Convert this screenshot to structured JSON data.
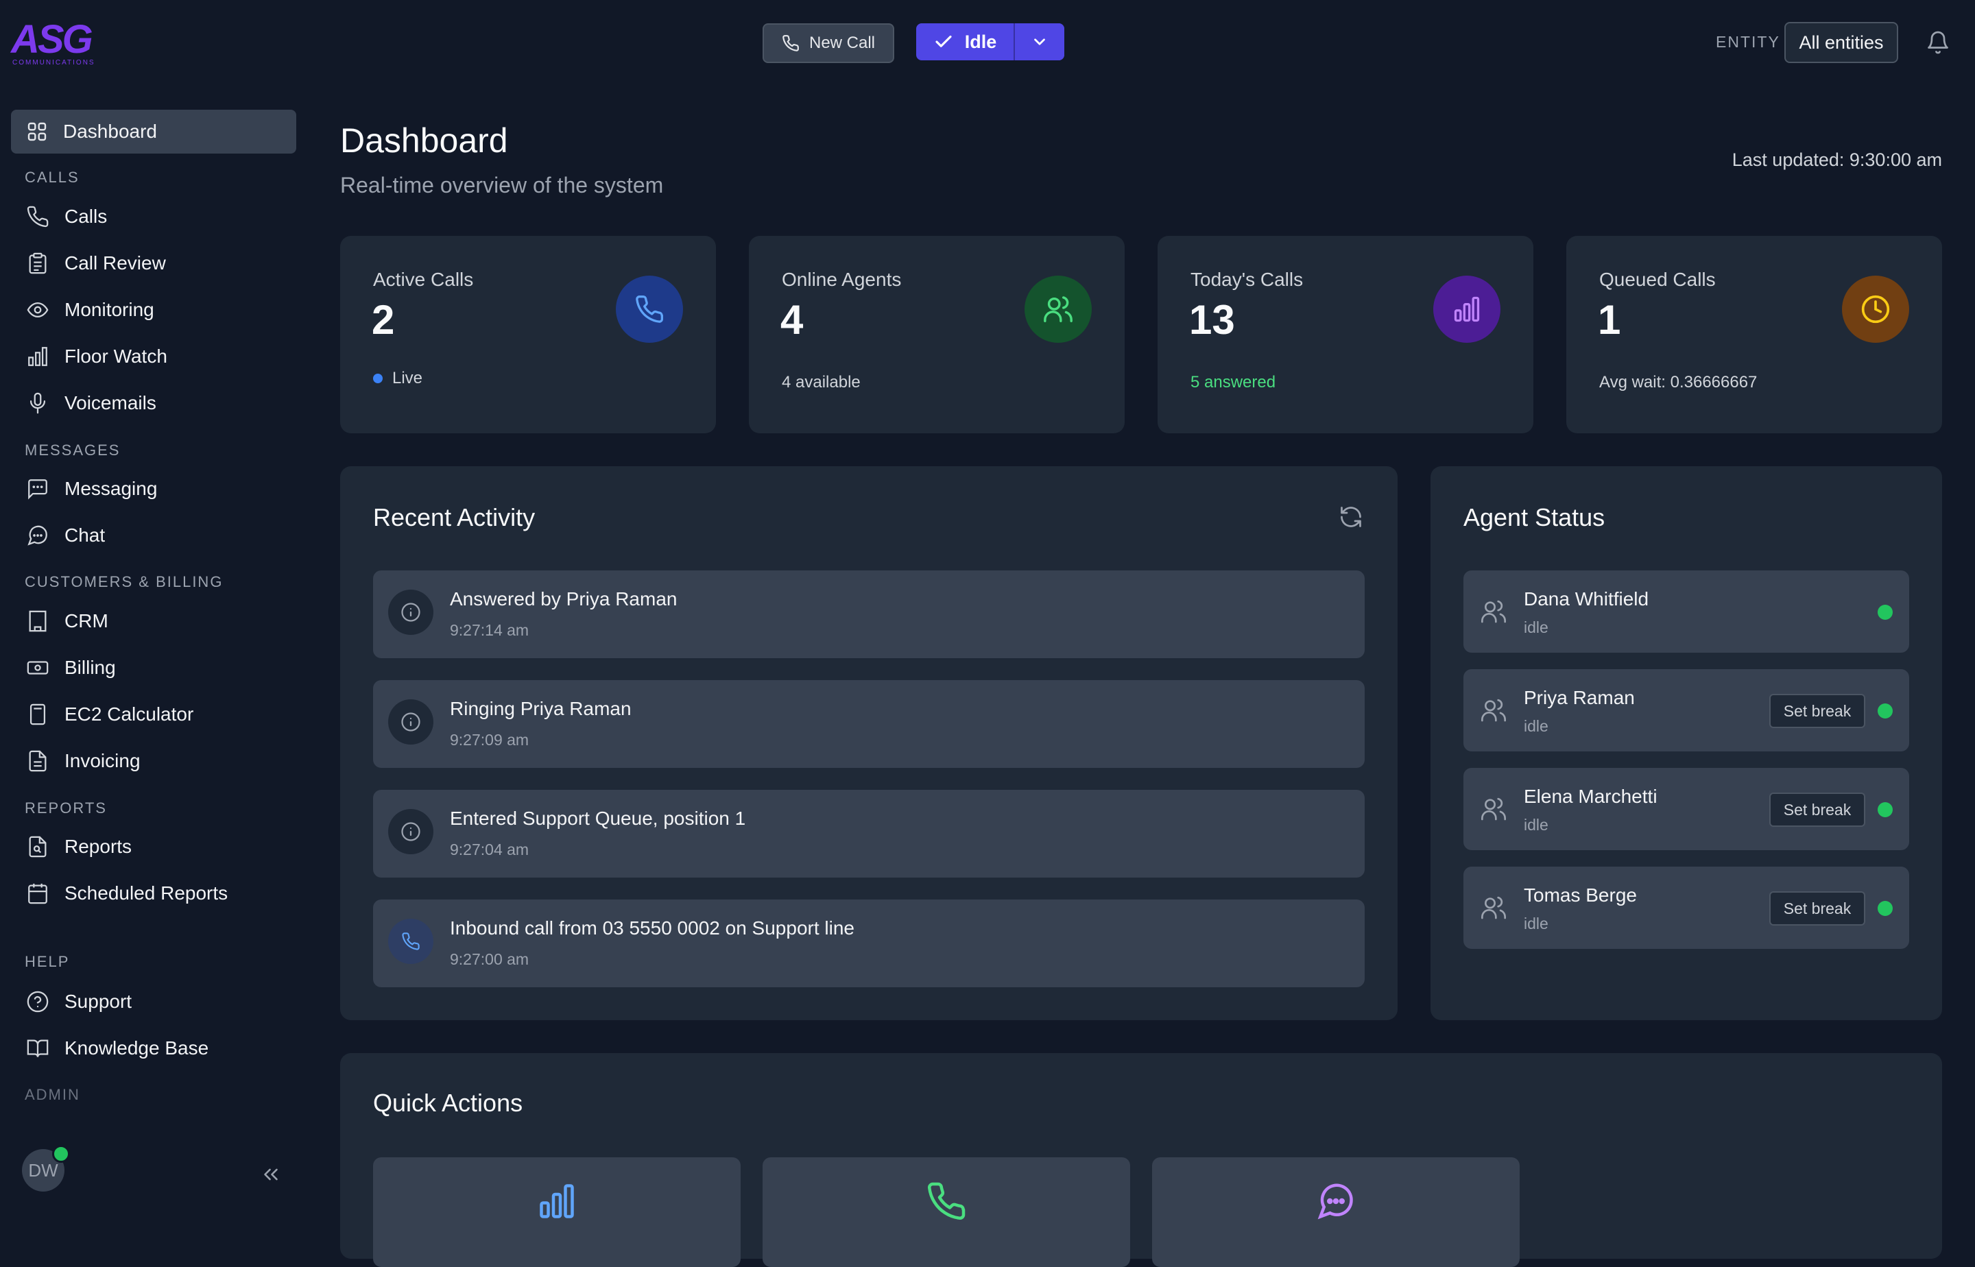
{
  "brand": {
    "logo_text": "ASG",
    "logo_sub": "COMMUNICATIONS",
    "color": "#7c3aed"
  },
  "topbar": {
    "new_call_label": "New Call",
    "status_label": "Idle",
    "entity_label": "ENTITY",
    "entity_value": "All entities"
  },
  "sidebar": {
    "active": {
      "label": "Dashboard",
      "icon": "grid-icon"
    },
    "sections": [
      {
        "label": "CALLS",
        "items": [
          {
            "label": "Calls",
            "icon": "phone-icon"
          },
          {
            "label": "Call Review",
            "icon": "clipboard-icon"
          },
          {
            "label": "Monitoring",
            "icon": "eye-icon"
          },
          {
            "label": "Floor Watch",
            "icon": "bar-chart-icon"
          },
          {
            "label": "Voicemails",
            "icon": "microphone-icon"
          }
        ]
      },
      {
        "label": "MESSAGES",
        "items": [
          {
            "label": "Messaging",
            "icon": "message-square-icon"
          },
          {
            "label": "Chat",
            "icon": "chat-bubble-icon"
          }
        ]
      },
      {
        "label": "CUSTOMERS & BILLING",
        "items": [
          {
            "label": "CRM",
            "icon": "building-icon"
          },
          {
            "label": "Billing",
            "icon": "banknote-icon"
          },
          {
            "label": "EC2 Calculator",
            "icon": "calculator-icon"
          },
          {
            "label": "Invoicing",
            "icon": "file-text-icon"
          }
        ]
      },
      {
        "label": "REPORTS",
        "items": [
          {
            "label": "Reports",
            "icon": "file-search-icon"
          },
          {
            "label": "Scheduled Reports",
            "icon": "calendar-icon"
          }
        ]
      },
      {
        "label": "HELP",
        "items": [
          {
            "label": "Support",
            "icon": "help-circle-icon"
          },
          {
            "label": "Knowledge Base",
            "icon": "book-icon"
          }
        ]
      },
      {
        "label": "ADMIN",
        "items": []
      }
    ],
    "user_initials": "DW"
  },
  "header": {
    "title": "Dashboard",
    "subtitle": "Real-time overview of the system",
    "last_updated": "Last updated: 9:30:00 am"
  },
  "stats": [
    {
      "label": "Active Calls",
      "value": "2",
      "sub": "Live",
      "icon": "phone-icon",
      "accent": "#60a5fa"
    },
    {
      "label": "Online Agents",
      "value": "4",
      "sub": "4 available",
      "icon": "users-icon",
      "accent": "#4ade80"
    },
    {
      "label": "Today's Calls",
      "value": "13",
      "sub": "5 answered",
      "icon": "bar-chart-icon",
      "accent": "#c084fc"
    },
    {
      "label": "Queued Calls",
      "value": "1",
      "sub": "Avg wait: 0.36666667",
      "icon": "clock-icon",
      "accent": "#facc15"
    }
  ],
  "recent_activity": {
    "title": "Recent Activity",
    "items": [
      {
        "text": "Answered by Priya Raman",
        "time": "9:27:14 am",
        "icon": "info-icon"
      },
      {
        "text": "Ringing Priya Raman",
        "time": "9:27:09 am",
        "icon": "info-icon"
      },
      {
        "text": "Entered Support Queue, position 1",
        "time": "9:27:04 am",
        "icon": "info-icon"
      },
      {
        "text": "Inbound call from 03 5550 0002 on Support line",
        "time": "9:27:00 am",
        "icon": "phone-icon"
      }
    ]
  },
  "agent_status": {
    "title": "Agent Status",
    "break_label": "Set break",
    "agents": [
      {
        "name": "Dana Whitfield",
        "status": "idle"
      },
      {
        "name": "Priya Raman",
        "status": "idle"
      },
      {
        "name": "Elena Marchetti",
        "status": "idle"
      },
      {
        "name": "Tomas Berge",
        "status": "idle"
      }
    ]
  },
  "quick_actions": {
    "title": "Quick Actions",
    "tiles": [
      {
        "icon": "bar-chart-icon",
        "accent": "#60a5fa"
      },
      {
        "icon": "phone-icon",
        "accent": "#4ade80"
      },
      {
        "icon": "message-circle-icon",
        "accent": "#c084fc"
      }
    ]
  }
}
